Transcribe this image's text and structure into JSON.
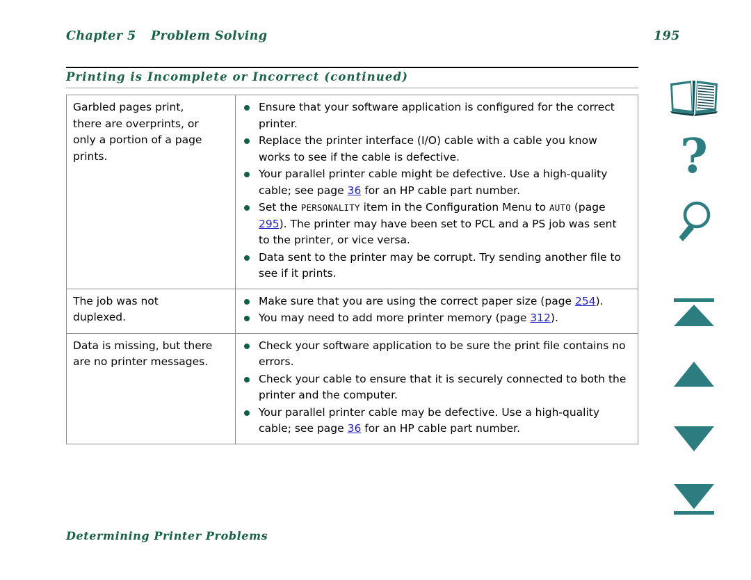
{
  "header": {
    "chapter": "Chapter 5",
    "chapter_title": "Problem Solving",
    "page_number": "195"
  },
  "section": {
    "title": "Printing is Incomplete or Incorrect (continued)"
  },
  "footer": {
    "title": "Determining Printer Problems"
  },
  "colors": {
    "heading_green": "#186246",
    "bullet_green": "#0d6048",
    "link_blue": "#1f1fc8",
    "icon_teal": "#2b7d80",
    "rule_black": "#000000",
    "rule_gray": "#9a9a9a",
    "table_border": "#8d8d8d"
  },
  "table": {
    "rows": [
      {
        "symptom": [
          "Garbled pages print,",
          "there are overprints, or",
          "only a portion of a page",
          "prints."
        ],
        "solutions": [
          {
            "parts": [
              {
                "t": "text",
                "v": "Ensure that your software application is configured for the correct printer."
              }
            ]
          },
          {
            "parts": [
              {
                "t": "text",
                "v": "Replace the printer interface (I/O) cable with a cable you know works to see if the cable is defective."
              }
            ]
          },
          {
            "parts": [
              {
                "t": "text",
                "v": "Your parallel printer cable might be defective. Use a high-quality cable; see page "
              },
              {
                "t": "link",
                "v": "36"
              },
              {
                "t": "text",
                "v": " for an HP cable part number."
              }
            ]
          },
          {
            "parts": [
              {
                "t": "text",
                "v": "Set the "
              },
              {
                "t": "mono",
                "v": "PERSONALITY"
              },
              {
                "t": "text",
                "v": " item in the Configuration Menu to "
              },
              {
                "t": "mono",
                "v": "AUTO"
              },
              {
                "t": "text",
                "v": " (page "
              },
              {
                "t": "link",
                "v": "295"
              },
              {
                "t": "text",
                "v": "). The printer may have been set to PCL and a PS job was sent to the printer, or vice versa."
              }
            ]
          },
          {
            "parts": [
              {
                "t": "text",
                "v": "Data sent to the printer may be corrupt. Try sending another file to see if it prints."
              }
            ]
          }
        ]
      },
      {
        "symptom": [
          "The job was not",
          "duplexed."
        ],
        "solutions": [
          {
            "parts": [
              {
                "t": "text",
                "v": "Make sure that you are using the correct paper size (page "
              },
              {
                "t": "link",
                "v": "254"
              },
              {
                "t": "text",
                "v": ")."
              }
            ]
          },
          {
            "parts": [
              {
                "t": "text",
                "v": "You may need to add more printer memory (page "
              },
              {
                "t": "link",
                "v": "312"
              },
              {
                "t": "text",
                "v": ")."
              }
            ]
          }
        ]
      },
      {
        "symptom": [
          "Data is missing, but there",
          "are no printer messages."
        ],
        "solutions": [
          {
            "parts": [
              {
                "t": "text",
                "v": "Check your software application to be sure the print file contains no errors."
              }
            ]
          },
          {
            "parts": [
              {
                "t": "text",
                "v": "Check your cable to ensure that it is securely connected to both the printer and the computer."
              }
            ]
          },
          {
            "parts": [
              {
                "t": "text",
                "v": "Your parallel printer cable may be defective. Use a high-quality cable; see page "
              },
              {
                "t": "link",
                "v": "36"
              },
              {
                "t": "text",
                "v": " for an HP cable part number."
              }
            ]
          }
        ]
      }
    ]
  },
  "rail": {
    "icons": [
      {
        "name": "book-icon",
        "label": "Contents"
      },
      {
        "name": "question-mark-icon",
        "label": "Help"
      },
      {
        "name": "magnifier-icon",
        "label": "Search"
      },
      {
        "name": "first-page-icon",
        "label": "First Page"
      },
      {
        "name": "previous-page-icon",
        "label": "Previous Page"
      },
      {
        "name": "next-page-icon",
        "label": "Next Page"
      },
      {
        "name": "last-page-icon",
        "label": "Last Page"
      }
    ]
  }
}
